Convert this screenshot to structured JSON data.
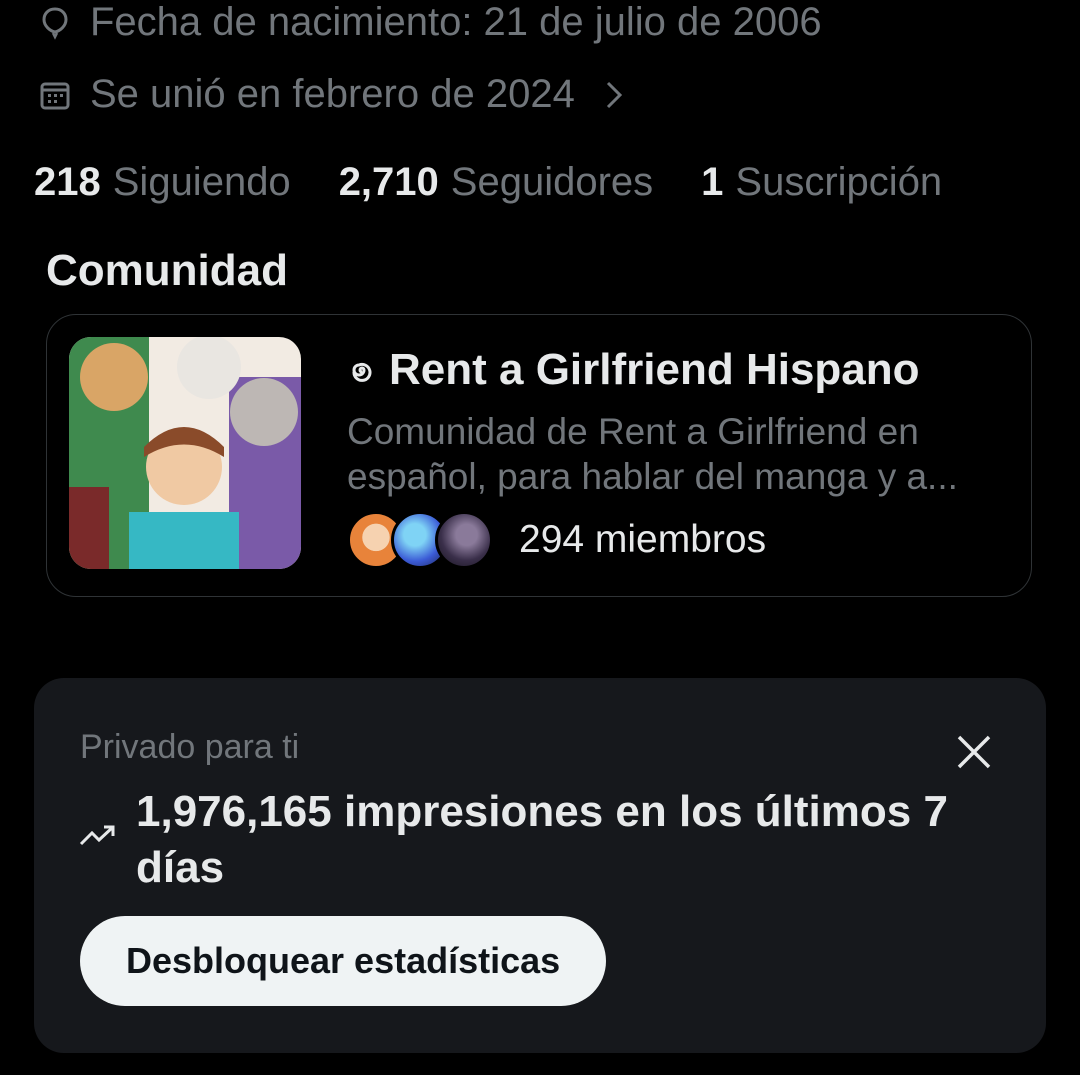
{
  "profile": {
    "birth_date": "Fecha de nacimiento: 21 de julio de 2006",
    "joined": "Se unió en febrero de 2024",
    "stats": [
      {
        "count": "218",
        "label": "Siguiendo"
      },
      {
        "count": "2,710",
        "label": "Seguidores"
      },
      {
        "count": "1",
        "label": "Suscripción"
      }
    ]
  },
  "community": {
    "section_title": "Comunidad",
    "name": "Rent a Girlfriend Hispano",
    "description": "Comunidad de Rent a Girlfriend en español, para hablar del manga y a...",
    "members": "294 miembros",
    "avatar_colors": [
      "#e8833a",
      "#3b5bd6",
      "#3a2f4a"
    ]
  },
  "insights": {
    "private_label": "Privado para ti",
    "impressions": "1,976,165 impresiones en los últimos 7 días",
    "unlock_label": "Desbloquear estadísticas"
  },
  "icons": {
    "birth": "balloon-icon",
    "joined": "calendar-icon",
    "joined_more": "chevron-right-icon",
    "community_badge": "spiral-icon",
    "close": "close-icon",
    "impressions": "trend-up-icon"
  }
}
